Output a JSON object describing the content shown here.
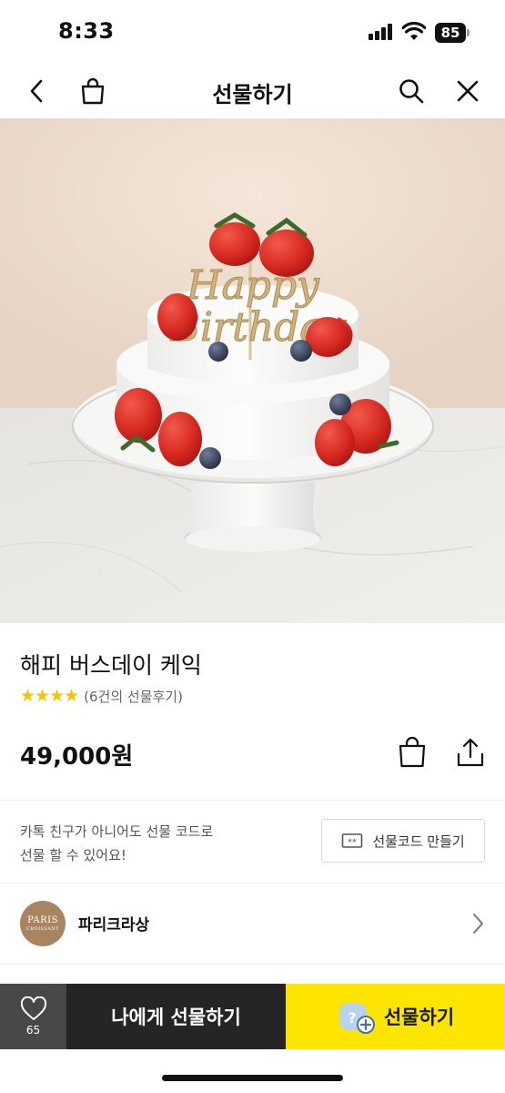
{
  "status_bar": {
    "time": "8:33",
    "battery": "85"
  },
  "nav": {
    "title": "선물하기"
  },
  "icons": {
    "back": "chevron-left-icon",
    "cart": "shopping-bag-icon",
    "search": "search-icon",
    "close": "close-icon",
    "share": "share-icon",
    "heart": "heart-icon",
    "ticket": "ticket-icon",
    "chevron": "chevron-right-icon"
  },
  "product": {
    "name": "해피 버스데이 케익",
    "rating_stars": "★★★★",
    "rating": 4,
    "review_text": "(6건의 선물후기)",
    "price": "49,000원",
    "image_topper_text": "Happy Birthday"
  },
  "gift_code": {
    "description_line1": "카톡 친구가 아니어도 선물 코드로",
    "description_line2": "선물 할 수 있어요!",
    "button_label": "선물코드 만들기"
  },
  "brand": {
    "logo_line1": "PARIS",
    "logo_line2": "CROISSANT",
    "name": "파리크라상"
  },
  "bottom_bar": {
    "wish_count": "65",
    "gift_to_me_label": "나에게 선물하기",
    "gift_label": "선물하기"
  },
  "colors": {
    "accent_yellow": "#fee500",
    "dark_button": "#252525",
    "wish_button": "#484848",
    "star": "#f5c400"
  }
}
